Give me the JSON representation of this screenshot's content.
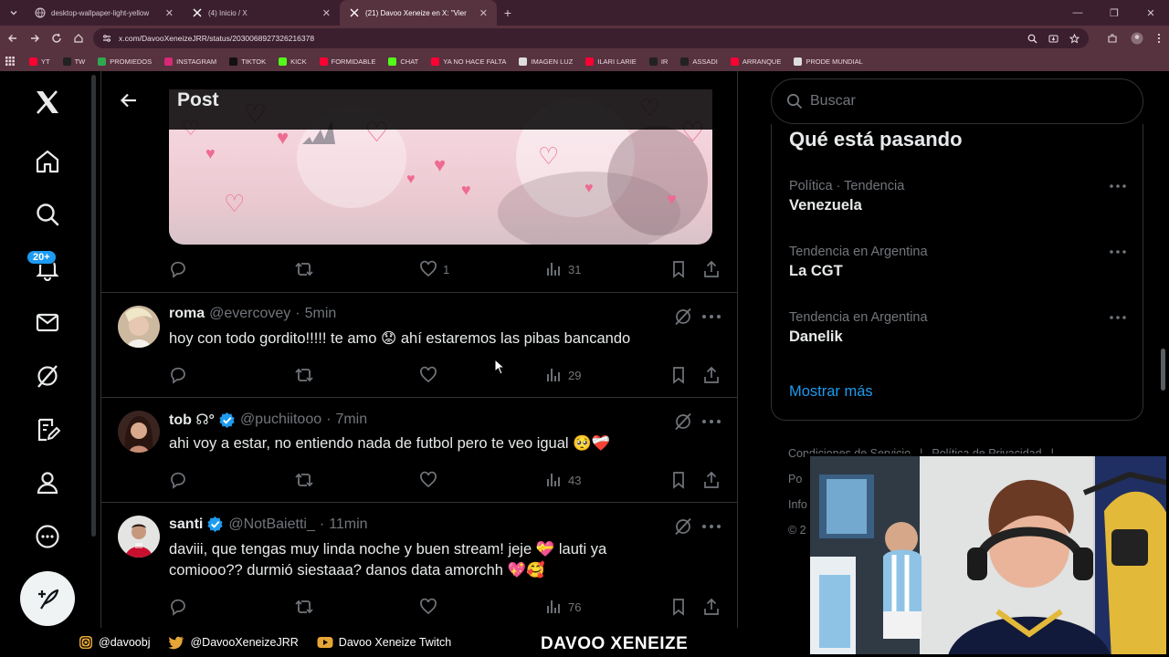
{
  "browser": {
    "tabs": [
      {
        "label": "desktop-wallpaper-light-yellow",
        "active": false
      },
      {
        "label": "(4) Inicio / X",
        "active": false
      },
      {
        "label": "(21) Davoo Xeneize en X: \"Vier",
        "active": true
      }
    ],
    "new_tab": "+",
    "url": "x.com/DavooXeneizeJRR/status/2030068927326216378",
    "bookmarks": [
      {
        "label": "YT",
        "color": "#ff0033"
      },
      {
        "label": "TW",
        "color": "#222222"
      },
      {
        "label": "PROMIEDOS",
        "color": "#2fa84f"
      },
      {
        "label": "INSTAGRAM",
        "color": "#d62976"
      },
      {
        "label": "TIKTOK",
        "color": "#111111"
      },
      {
        "label": "KICK",
        "color": "#53fc18"
      },
      {
        "label": "FORMIDABLE",
        "color": "#ff0033"
      },
      {
        "label": "CHAT",
        "color": "#53fc18"
      },
      {
        "label": "YA NO HACE FALTA",
        "color": "#ff0033"
      },
      {
        "label": "IMAGEN LUZ",
        "color": "#dddddd"
      },
      {
        "label": "ILARI LARIE",
        "color": "#ff0033"
      },
      {
        "label": "IR",
        "color": "#222222"
      },
      {
        "label": "ASSADI",
        "color": "#222222"
      },
      {
        "label": "ARRANQUE",
        "color": "#ff0033"
      },
      {
        "label": "PRODE MUNDIAL",
        "color": "#dddddd"
      }
    ]
  },
  "nav": {
    "notifications_badge": "20+"
  },
  "post": {
    "header_title": "Post",
    "main_actions": {
      "likes": "1",
      "views": "31"
    }
  },
  "replies": [
    {
      "name": "roma",
      "handle": "@evercovey",
      "time": "5min",
      "verified": false,
      "text": "hoy con todo gordito!!!!! te amo 😟 ahí estaremos las pibas bancando",
      "likes": "",
      "views": "29"
    },
    {
      "name": "tob ☊°",
      "handle": "@puchiitooo",
      "time": "7min",
      "verified": true,
      "text": "ahi voy a estar, no entiendo nada de futbol pero te veo igual 🥺❤️‍🩹",
      "likes": "",
      "views": "43"
    },
    {
      "name": "santi",
      "handle": "@NotBaietti_",
      "time": "11min",
      "verified": true,
      "text": "daviii, que tengas muy linda noche y buen stream! jeje 💝 lauti ya comiooo?? durmió siestaaa? danos data amorchh 💖🥰",
      "likes": "",
      "views": "76"
    }
  ],
  "sidebar": {
    "search_placeholder": "Buscar",
    "trends_title": "Qué está pasando",
    "trends": [
      {
        "meta": "Política · Tendencia",
        "name": "Venezuela"
      },
      {
        "meta": "Tendencia en Argentina",
        "name": "La CGT"
      },
      {
        "meta": "Tendencia en Argentina",
        "name": "Danelik"
      }
    ],
    "show_more": "Mostrar más",
    "footer_links": [
      "Condiciones de Servicio",
      "|",
      "Política de Privacidad",
      "|"
    ],
    "footer_partial": [
      "Po",
      "Info",
      "© 2"
    ]
  },
  "stream": {
    "instagram": "@davoobj",
    "twitter": "@DavooXeneizeJRR",
    "youtube": "Davoo Xeneize Twitch",
    "title": "DAVOO XENEIZE"
  },
  "colors": {
    "accent": "#1d9bf0",
    "browser_frame": "#57323f",
    "browser_tabs": "#3b1f2e"
  }
}
